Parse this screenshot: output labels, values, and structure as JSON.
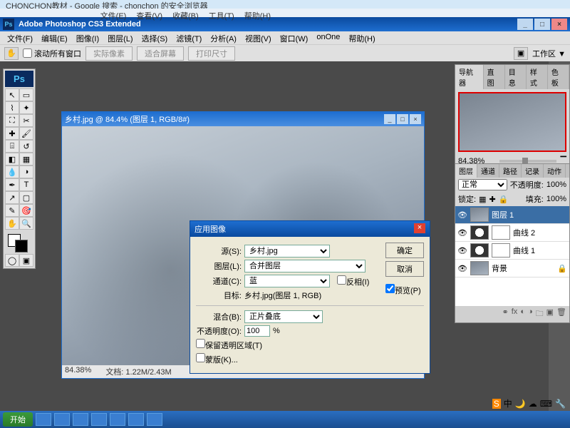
{
  "browser": {
    "tab_title": "CHONCHON教材 - Google 搜索 - chonchon 的安全浏览器"
  },
  "browser_menu": [
    "文件(E)",
    "查看(V)",
    "收藏(B)",
    "工具(T)",
    "帮助(H)"
  ],
  "app_title": "Adobe Photoshop CS3 Extended",
  "main_menu": [
    "文件(F)",
    "编辑(E)",
    "图像(I)",
    "图层(L)",
    "选择(S)",
    "滤镜(T)",
    "分析(A)",
    "视图(V)",
    "窗口(W)",
    "onOne",
    "帮助(H)"
  ],
  "options": {
    "scroll_all": "滚动所有窗口",
    "btn_actual": "实际像素",
    "btn_fit": "适合屏幕",
    "btn_print": "打印尺寸",
    "workspace_label": "工作区 ▼"
  },
  "doc": {
    "title": "乡村.jpg @ 84.4% (图层 1, RGB/8#)",
    "zoom": "84.38%",
    "filesize": "文档: 1.22M/2.43M"
  },
  "dialog": {
    "title": "应用图像",
    "source_lbl": "源(S):",
    "source_val": "乡村.jpg",
    "layer_lbl": "图层(L):",
    "layer_val": "合并图层",
    "channel_lbl": "通道(C):",
    "channel_val": "蓝",
    "invert_lbl": "反相(I)",
    "target_lbl": "目标:",
    "target_val": "乡村.jpg(图层 1, RGB)",
    "blend_lbl": "混合(B):",
    "blend_val": "正片叠底",
    "opacity_lbl": "不透明度(O):",
    "opacity_val": "100",
    "opacity_pct": "%",
    "preserve_lbl": "保留透明区域(T)",
    "mask_lbl": "蒙版(K)...",
    "ok": "确定",
    "cancel": "取消",
    "preview": "预览(P)"
  },
  "nav_panel": {
    "tabs": [
      "导航器",
      "直图",
      "目息",
      "样式",
      "色板"
    ],
    "zoom": "84.38%"
  },
  "layers_panel": {
    "tabs": [
      "图层",
      "通道",
      "路径",
      "记录",
      "动作"
    ],
    "mode": "正常",
    "opacity_lbl": "不透明度:",
    "opacity_val": "100%",
    "lock_lbl": "锁定:",
    "fill_lbl": "填充:",
    "fill_val": "100%",
    "layers": [
      {
        "name": "图层 1",
        "sel": true,
        "type": "img"
      },
      {
        "name": "曲线 2",
        "sel": false,
        "type": "adj"
      },
      {
        "name": "曲线 1",
        "sel": false,
        "type": "adj"
      },
      {
        "name": "背景",
        "sel": false,
        "type": "bg"
      }
    ]
  },
  "taskbar": {
    "start": "开始"
  },
  "tray_text": "中"
}
